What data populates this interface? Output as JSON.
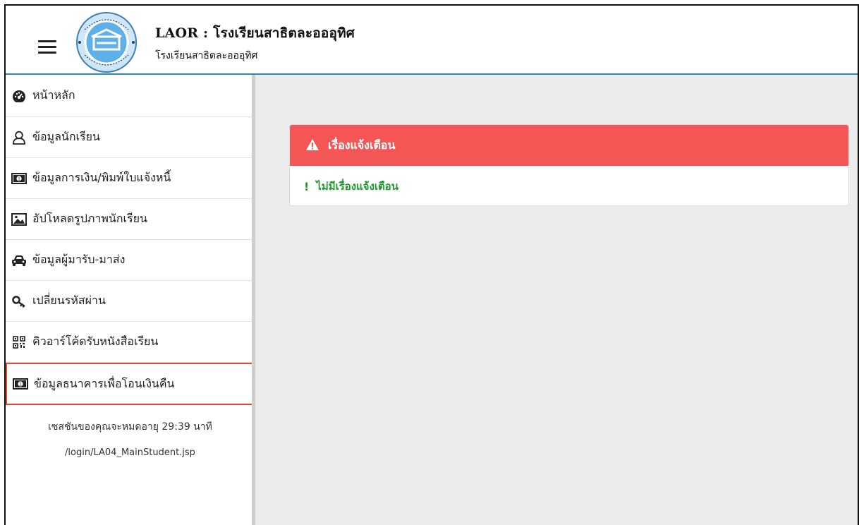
{
  "header": {
    "title": "LAOR : โรงเรียนสาธิตละอออุทิศ",
    "subtitle": "โรงเรียนสาธิตละอออุทิศ"
  },
  "sidebar": {
    "items": [
      {
        "label": "หน้าหลัก",
        "icon": "dashboard-icon"
      },
      {
        "label": "ข้อมูลนักเรียน",
        "icon": "user-icon"
      },
      {
        "label": "ข้อมูลการเงิน/พิมพ์ใบแจ้งหนี้",
        "icon": "money-icon"
      },
      {
        "label": "อัปโหลดรูปภาพนักเรียน",
        "icon": "image-icon"
      },
      {
        "label": "ข้อมูลผู้มารับ-มาส่ง",
        "icon": "car-icon"
      },
      {
        "label": "เปลี่ยนรหัสผ่าน",
        "icon": "key-icon"
      },
      {
        "label": "คิวอาร์โค้ดรับหนังสือเรียน",
        "icon": "qrcode-icon"
      },
      {
        "label": "ข้อมูลธนาคารเพื่อโอนเงินคืน",
        "icon": "money-icon"
      }
    ],
    "session_text": "เซสชันของคุณจะหมดอายุ 29:39 นาที",
    "path_text": "/login/LA04_MainStudent.jsp"
  },
  "alert": {
    "title": "เรื่องแจ้งเตือน",
    "message": "ไม่มีเรื่องแจ้งเตือน",
    "bang": "!"
  },
  "colors": {
    "accent": "#2e86c1",
    "alert_header": "#f45656",
    "success_text": "#1e9a2e",
    "selected_border": "#e8472c"
  }
}
